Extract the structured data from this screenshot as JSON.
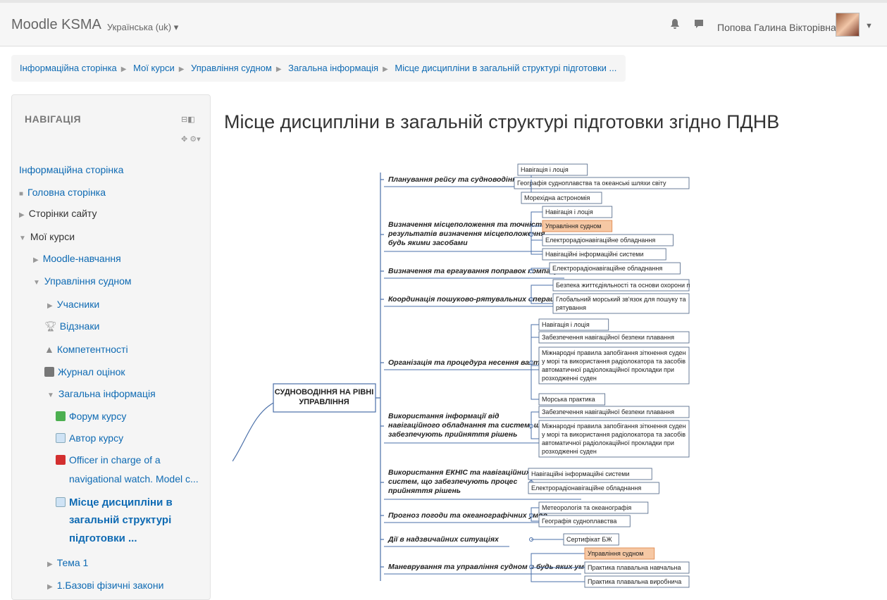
{
  "header": {
    "brand": "Moodle KSMA",
    "language": "Українська (uk) ▾",
    "user_name": "Попова Галина Вікторівна"
  },
  "breadcrumb": [
    "Інформаційна сторінка",
    "Мої курси",
    "Управління судном",
    "Загальна інформація",
    "Місце дисципліни в загальній структурі підготовки ..."
  ],
  "nav": {
    "title": "НАВІГАЦІЯ",
    "home": "Інформаційна сторінка",
    "items": [
      "Головна сторінка",
      "Сторінки сайту",
      "Мої курси",
      "Moodle-навчання",
      "Управління судном",
      "Учасники",
      "Відзнаки",
      "Компетентності",
      "Журнал оцінок",
      "Загальна інформація",
      "Форум курсу",
      "Автор курсу",
      "Officer in charge of a",
      "navigational watch. Model c...",
      "Місце дисципліни в",
      "загальній структурі",
      "підготовки ...",
      "Тема 1",
      "1.Базові фізичні закони"
    ]
  },
  "page_title": "Місце дисципліни в загальній структурі підготовки згідно ПДНВ",
  "mindmap": {
    "root": [
      "СУДНОВОДІННЯ НА РІВНІ",
      "УПРАВЛІННЯ"
    ],
    "branches": [
      {
        "label": [
          "Планування рейсу та судноводіння"
        ],
        "leaves": [
          "Навігація і лоція",
          "Географія судноплавства та океанські шляхи світу",
          "Морехідна астрономія"
        ]
      },
      {
        "label": [
          "Визначення місцеположення та точність",
          "результатів визначення місцеположення",
          "будь якими засобами"
        ],
        "leaves": [
          "Навігація і лоція",
          "Управління судном",
          "Електрорадіонавігаційне обладнання",
          "Навігаційні інформаційні системи"
        ]
      },
      {
        "label": [
          "Визначення та ергаування поправок компасу"
        ],
        "leaves": [
          "Електрорадіонавігаційне обладнання"
        ]
      },
      {
        "label": [
          "Координація пошуково-рятувальних операцій"
        ],
        "leaves": [
          "Безпека життєдіяльності та основи охорони п",
          "Глобальний морський зв'язок для пошуку та|рятування"
        ]
      },
      {
        "label": [
          "Організація та процедура несення вахти"
        ],
        "leaves": [
          "Навігація і лоція",
          "Забезпечення навігаційної безпеки плавання",
          "Міжнародні правила запобігання зіткнення суден|у морі та використання радіолокатора та засобів|автоматичної радіолокаційної прокладки при|розходженні суден",
          "Морська практика"
        ]
      },
      {
        "label": [
          "Використання інформації від",
          "навігаційного обладнання та систем, що",
          "забезпечують прийняття рішень"
        ],
        "leaves": [
          "Забезпечення навігаційної безпеки плавання",
          "Міжнародні правила запобігання зіткнення суден|у морі та використання радіолокатора та засобів|автоматичної радіолокаційної прокладки при|розходженні суден"
        ]
      },
      {
        "label": [
          "Використання ЕКНІС та   навігаційних",
          "систем, що забезпечують процес",
          "прийняття рішень"
        ],
        "leaves": [
          "Навігаційні інформаційні системи",
          "Електрорадіонавігаційне обладнання"
        ]
      },
      {
        "label": [
          "Прогноз погоди та океанографічних умов"
        ],
        "leaves": [
          "Метеорологія та океанографія",
          "Географія судноплавства"
        ]
      },
      {
        "label": [
          "Дії в надзвичайних ситуаціях"
        ],
        "leaves": [
          "Сертифікат БЖ"
        ]
      },
      {
        "label": [
          "Маневрування та управління судном в будь яких умовах"
        ],
        "leaves": [
          "Управління судном",
          "Практика плавальна навчальна",
          "Практика плавальна виробнича"
        ]
      }
    ]
  },
  "colors": {
    "link": "#0e6ab3",
    "highlight": "#f6c8a4",
    "line": "#4a6fa8"
  }
}
